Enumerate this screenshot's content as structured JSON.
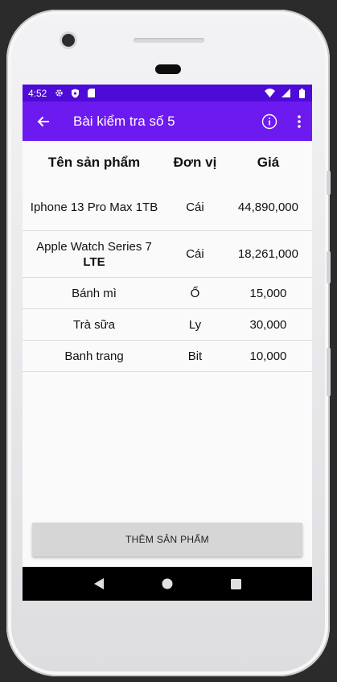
{
  "status_bar": {
    "time": "4:52",
    "icons": [
      "gear-icon",
      "shield-icon",
      "sd-card-icon",
      "wifi-icon",
      "signal-icon",
      "battery-icon"
    ]
  },
  "app_bar": {
    "title": "Bài kiểm tra số 5",
    "icons": [
      "back-arrow-icon",
      "info-icon",
      "more-vertical-icon"
    ]
  },
  "table": {
    "headers": {
      "name": "Tên sản phẩm",
      "unit": "Đơn vị",
      "price": "Giá"
    },
    "rows": [
      {
        "name": "Iphone 13 Pro Max 1TB",
        "unit": "Cái",
        "price": "44,890,000"
      },
      {
        "name": "Apple Watch Series 7 ",
        "name_bold": "LTE",
        "unit": "Cái",
        "price": "18,261,000"
      },
      {
        "name": "Bánh mì",
        "unit": "Ổ",
        "price": "15,000"
      },
      {
        "name": "Trà sữa",
        "unit": "Ly",
        "price": "30,000"
      },
      {
        "name": "Banh trang",
        "unit": "Bit",
        "price": "10,000"
      }
    ]
  },
  "add_button": {
    "label": "THÊM SẢN PHẨM"
  },
  "nav_bar": {
    "icons": [
      "back-triangle-icon",
      "home-circle-icon",
      "recents-square-icon"
    ]
  },
  "colors": {
    "status_bar": "#4e0ad6",
    "app_bar": "#6d1af0",
    "button": "#d6d6d6"
  }
}
